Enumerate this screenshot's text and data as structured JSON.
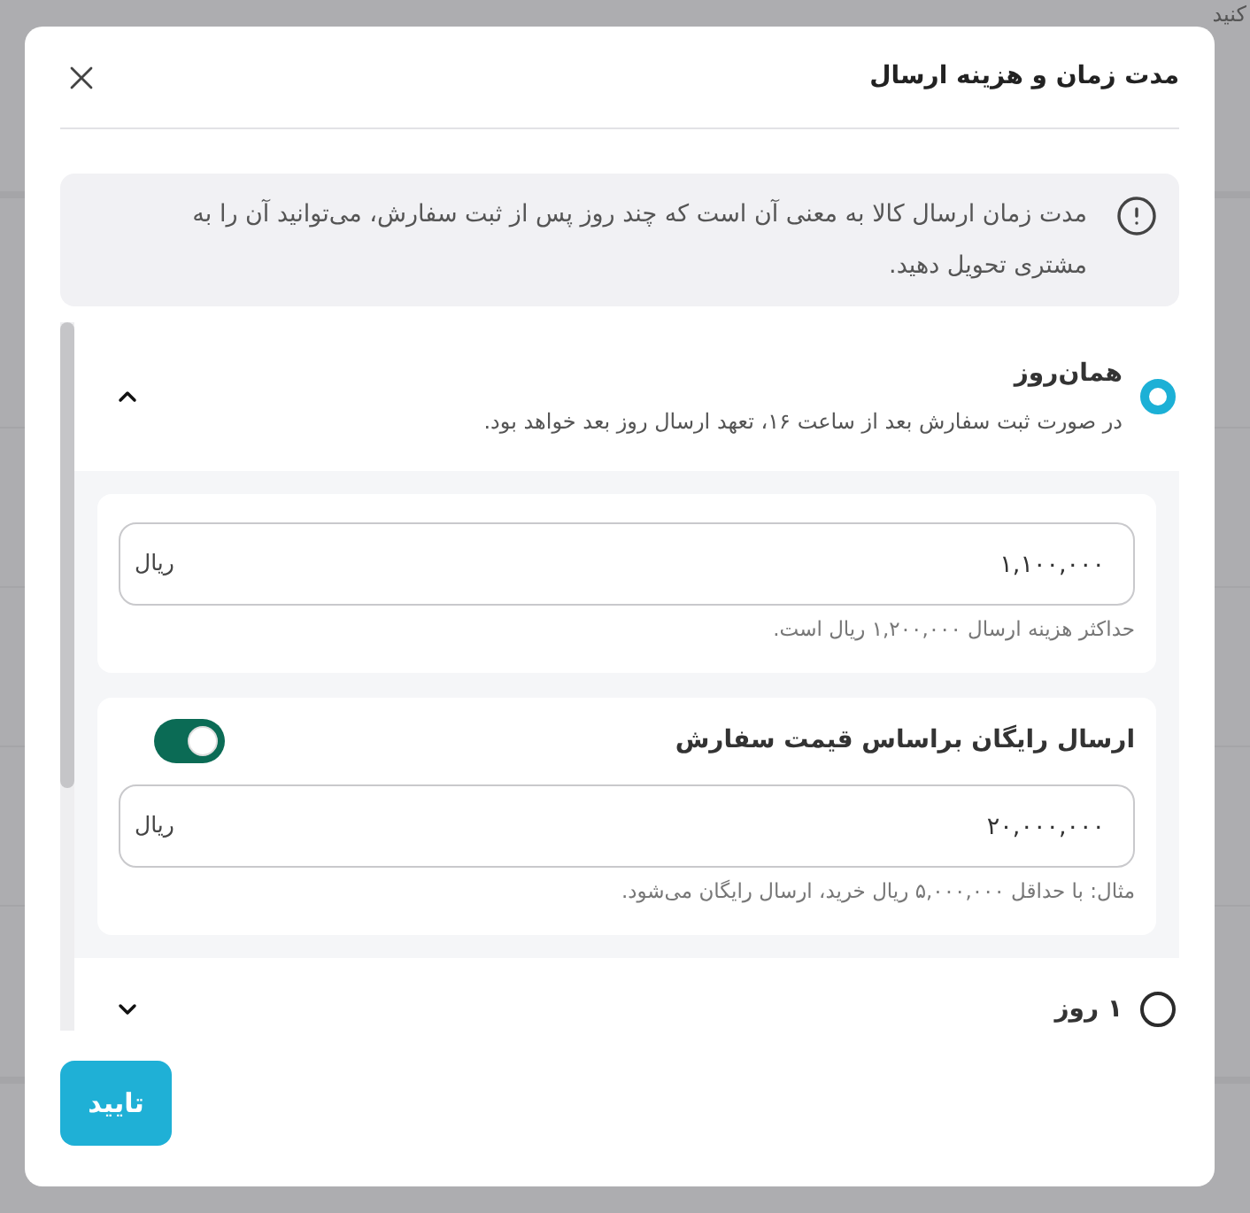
{
  "backdrop": {
    "text": "کنید"
  },
  "dialog": {
    "title": "مدت زمان و هزینه ارسال",
    "info": "مدت زمان ارسال کالا به معنی آن است که چند روز پس از ثبت سفارش، می‌توانید آن را به مشتری تحویل دهید.",
    "options": [
      {
        "label": "همان‌روز",
        "description": "در صورت ثبت سفارش بعد از ساعت ۱۶، تعهد ارسال روز بعد خواهد بود.",
        "selected": true,
        "expanded": true,
        "cost": {
          "value": "۱,۱۰۰,۰۰۰",
          "unit": "ریال",
          "hint": "حداکثر هزینه ارسال ۱,۲۰۰,۰۰۰ ریال است."
        },
        "free_shipping": {
          "label": "ارسال رایگان براساس قیمت سفارش",
          "on": true,
          "value": "۲۰,۰۰۰,۰۰۰",
          "unit": "ریال",
          "hint": "مثال: با حداقل ۵,۰۰۰,۰۰۰ ریال خرید، ارسال رایگان می‌شود."
        }
      },
      {
        "label": "۱ روز",
        "selected": false,
        "expanded": false
      }
    ],
    "confirm_button": "تایید"
  }
}
